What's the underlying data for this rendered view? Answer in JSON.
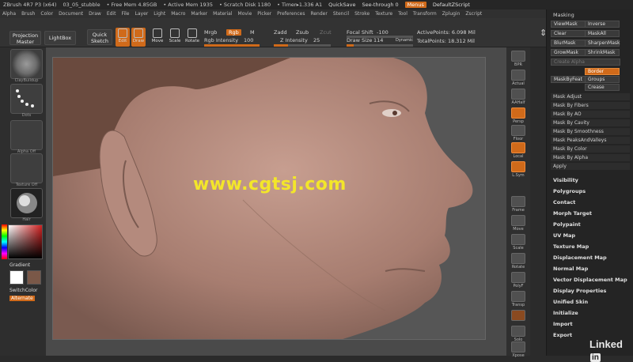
{
  "titlebar": {
    "app": "ZBrush 4R7 P3 (x64)",
    "doc": "03_05_stubble",
    "free_mem": "• Free Mem 4.85GB",
    "active_mem": "• Active Mem 1935",
    "scratch": "• Scratch Disk 1180",
    "timer": "• Timer▸1.336 A1",
    "quicksave": "QuickSave",
    "seethrough": "See-through 0",
    "menus": "Menus",
    "defaultscript": "DefaultZScript"
  },
  "menubar": [
    "Alpha",
    "Brush",
    "Color",
    "Document",
    "Draw",
    "Edit",
    "File",
    "Layer",
    "Light",
    "Macro",
    "Marker",
    "Material",
    "Movie",
    "Picker",
    "Preferences",
    "Render",
    "Stencil",
    "Stroke",
    "Texture",
    "Tool",
    "Transform",
    "Zplugin",
    "Zscript"
  ],
  "shelf": {
    "projection_master": "Projection Master",
    "lightbox": "LightBox",
    "quick_sketch": "Quick Sketch",
    "edit": "Edit",
    "draw": "Draw",
    "move": "Move",
    "scale": "Scale",
    "rotate": "Rotate",
    "mrgb": "Mrgb",
    "rgb": "Rgb",
    "m": "M",
    "rgb_intensity_label": "Rgb Intensity",
    "rgb_intensity": "100",
    "rgb_intensity_pct": 100,
    "zadd": "Zadd",
    "zsub": "Zsub",
    "zcut": "Zcut",
    "z_intensity_label": "Z Intensity",
    "z_intensity": "25",
    "z_intensity_pct": 25,
    "focal_shift_label": "Focal Shift",
    "focal_shift": "-100",
    "draw_size_label": "Draw Size",
    "draw_size": "114",
    "draw_size_pct": 11,
    "dynamic": "Dynamic",
    "active_points": "ActivePoints: 6.098 Mil",
    "total_points": "TotalPoints: 18.312 Mil"
  },
  "leftshelf": {
    "brush_label": "ClayBuildup",
    "stroke_label": "Dots",
    "alpha_label": "Alpha Off",
    "texture_label": "Texture Off",
    "material_label": "Hair",
    "gradient": "Gradient",
    "switchcolor": "SwitchColor",
    "alternate": "Alternate"
  },
  "viewport": {
    "watermark": "www.cgtsj.com"
  },
  "rightstrip": [
    "BPR",
    "Actual",
    "AAHalf",
    "Persp",
    "Floor",
    "Local",
    "L.Sym",
    "Frame",
    "Move",
    "Scale",
    "Rotate",
    "PolyF",
    "Transp",
    "Solo",
    "Xpose"
  ],
  "palette": {
    "title": "Masking",
    "viewmask": "ViewMask",
    "inverse": "Inverse",
    "clear": "Clear",
    "maskall": "MaskAll",
    "blurmask": "BlurMask",
    "sharpenmask": "SharpenMask",
    "growmask": "GrowMask",
    "shrinkmask": "ShrinkMask",
    "create_alpha": "Create Alpha",
    "border": "Border",
    "maskbyfeature": "MaskByFeat",
    "groups": "Groups",
    "crease": "Crease",
    "mask_items": [
      "Mask Adjust",
      "Mask By Fibers",
      "Mask By AO",
      "Mask By Cavity",
      "Mask By Smoothness",
      "Mask PeaksAndValleys",
      "Mask By Color",
      "Mask By Alpha",
      "Apply"
    ],
    "subpalettes": [
      "Visibility",
      "Polygroups",
      "Contact",
      "Morph Target",
      "Polypaint",
      "UV Map",
      "Texture Map",
      "Displacement Map",
      "Normal Map",
      "Vector Displacement Map",
      "Display Properties",
      "Unified Skin",
      "Initialize",
      "Import",
      "Export"
    ]
  },
  "watermark_brand": {
    "text": "Linked",
    "mark": "in"
  },
  "colors": {
    "accent": "#d06a1a",
    "bg": "#2b2b2b",
    "watermark": "#f3e62a"
  }
}
